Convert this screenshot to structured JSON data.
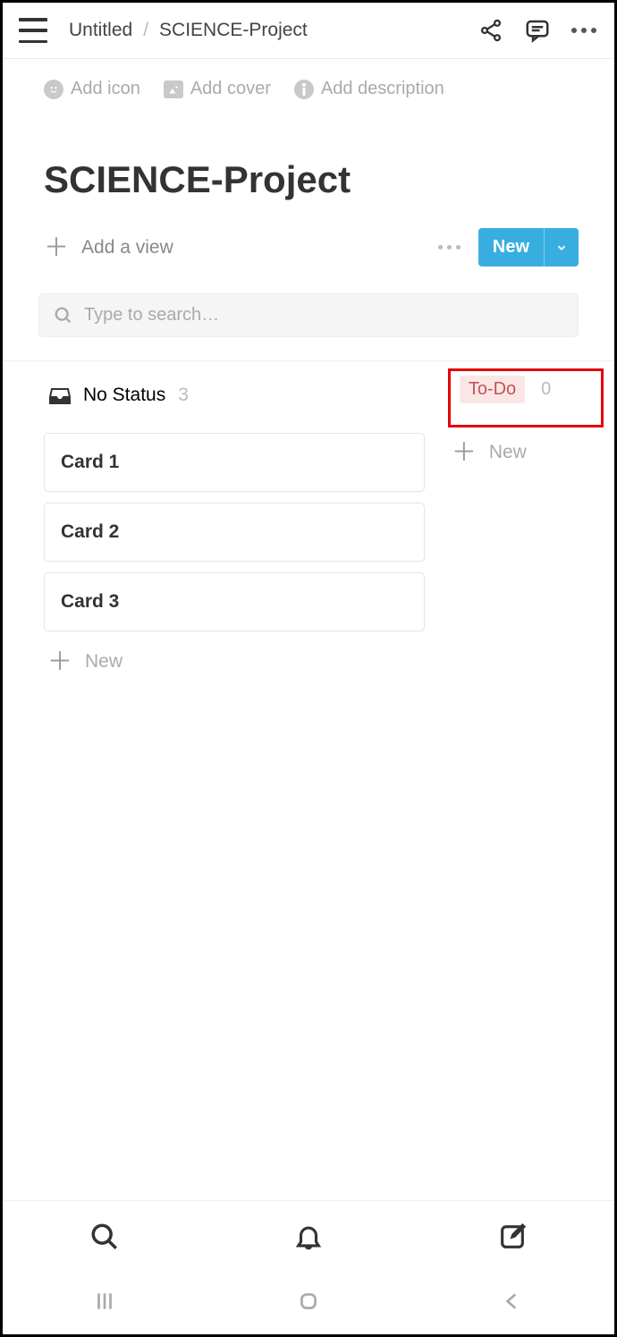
{
  "header": {
    "breadcrumb_parent": "Untitled",
    "breadcrumb_current": "SCIENCE-Project"
  },
  "page_options": {
    "add_icon": "Add icon",
    "add_cover": "Add cover",
    "add_description": "Add description"
  },
  "title": "SCIENCE-Project",
  "views": {
    "add_view_label": "Add a view",
    "new_button_label": "New"
  },
  "search": {
    "placeholder": "Type to search…"
  },
  "board": {
    "columns": [
      {
        "name": "No Status",
        "count": "3",
        "cards": [
          "Card 1",
          "Card 2",
          "Card 3"
        ],
        "new_label": "New"
      },
      {
        "name": "To-Do",
        "count": "0",
        "cards": [],
        "new_label": "New"
      }
    ]
  }
}
